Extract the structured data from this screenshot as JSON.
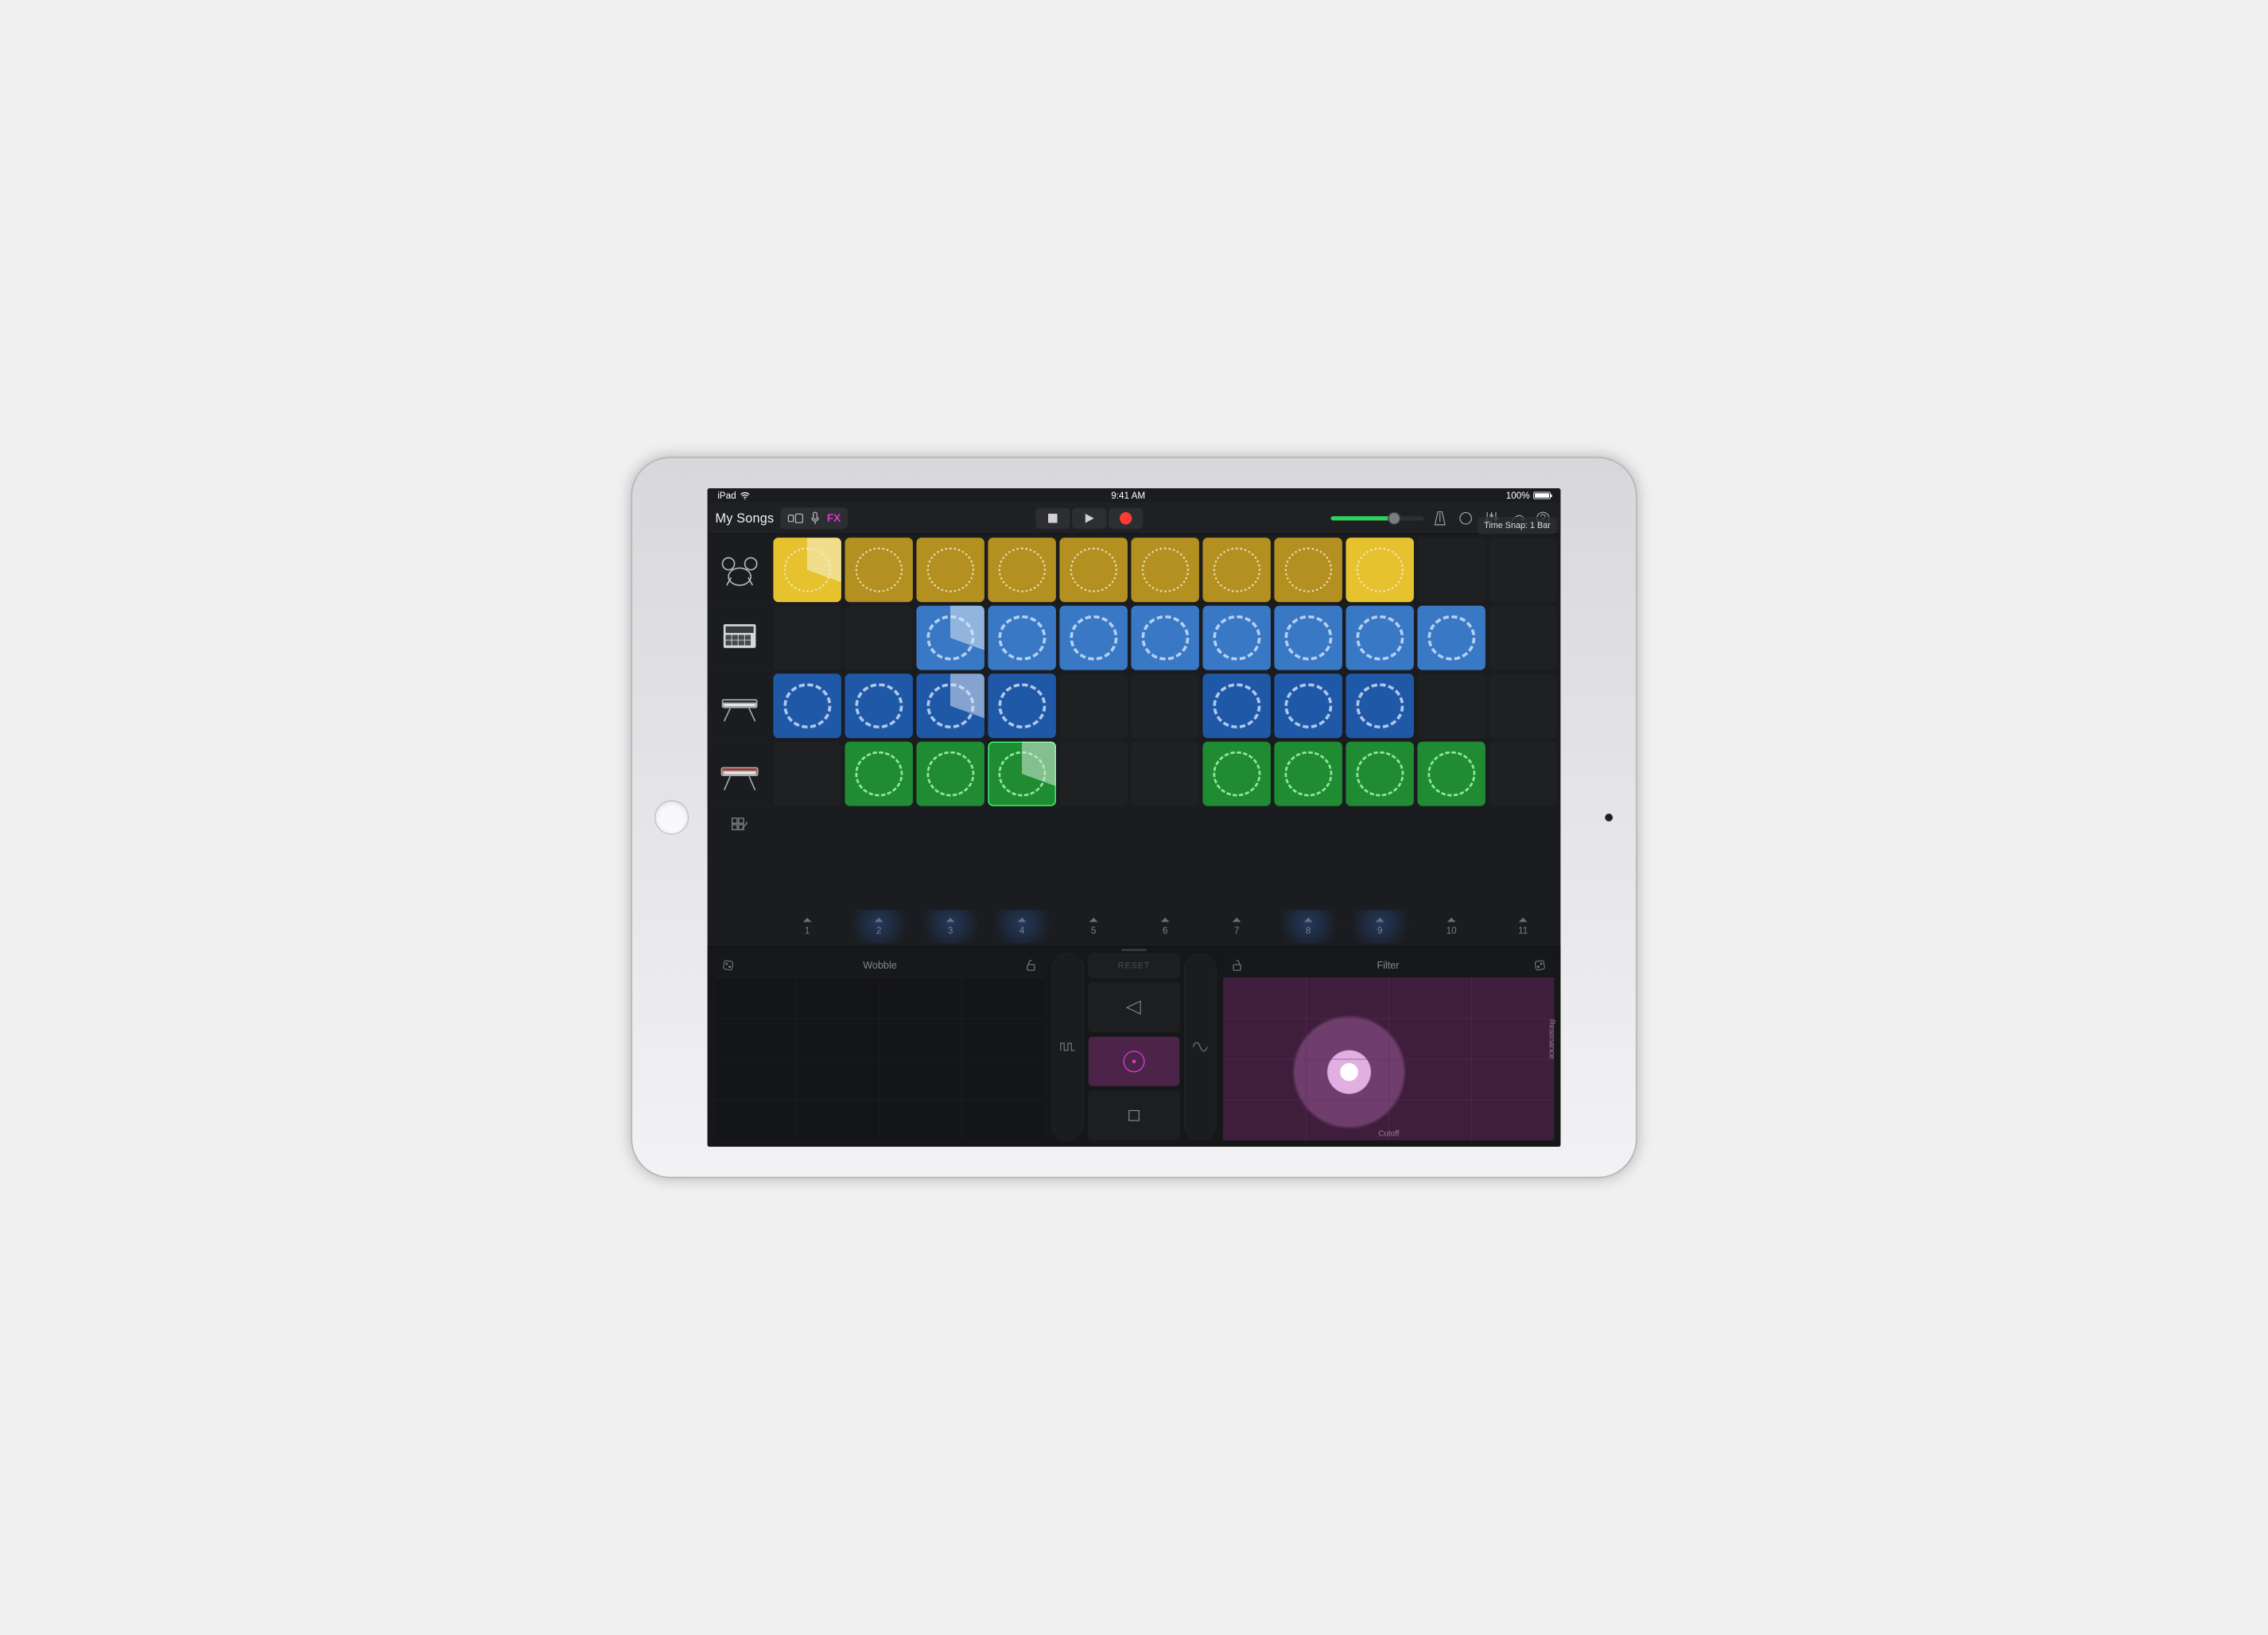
{
  "status": {
    "device": "iPad",
    "time": "9:41 AM",
    "battery": "100%"
  },
  "toolbar": {
    "title": "My Songs",
    "fx_label": "FX",
    "snap_label": "Time Snap: 1 Bar"
  },
  "tracks": [
    {
      "name": "Drums",
      "icon": "drums"
    },
    {
      "name": "Sampler",
      "icon": "sampler"
    },
    {
      "name": "Keys",
      "icon": "keys"
    },
    {
      "name": "Synth",
      "icon": "synth"
    }
  ],
  "columns": [
    "1",
    "2",
    "3",
    "4",
    "5",
    "6",
    "7",
    "8",
    "9",
    "10",
    "11"
  ],
  "column_glow": [
    false,
    true,
    true,
    true,
    false,
    false,
    false,
    true,
    true,
    false,
    false
  ],
  "grid": [
    [
      {
        "c": "yellow",
        "state": "playing",
        "bright": true
      },
      {
        "c": "yellow"
      },
      {
        "c": "yellow"
      },
      {
        "c": "yellow"
      },
      {
        "c": "yellow"
      },
      {
        "c": "yellow"
      },
      {
        "c": "yellow"
      },
      {
        "c": "yellow"
      },
      {
        "c": "yellow",
        "bright": true
      },
      null,
      null
    ],
    [
      null,
      null,
      {
        "c": "blue-lt",
        "state": "playing"
      },
      {
        "c": "blue-lt"
      },
      {
        "c": "blue-lt"
      },
      {
        "c": "blue-lt"
      },
      {
        "c": "blue-lt"
      },
      {
        "c": "blue-lt"
      },
      {
        "c": "blue-lt"
      },
      {
        "c": "blue-lt"
      },
      null
    ],
    [
      {
        "c": "blue-dk"
      },
      {
        "c": "blue-dk"
      },
      {
        "c": "blue-dk",
        "state": "playing"
      },
      {
        "c": "blue-dk"
      },
      null,
      null,
      {
        "c": "blue-dk"
      },
      {
        "c": "blue-dk"
      },
      {
        "c": "blue-dk"
      },
      null,
      null
    ],
    [
      null,
      {
        "c": "green"
      },
      {
        "c": "green"
      },
      {
        "c": "green",
        "state": "playing",
        "selected": true
      },
      null,
      null,
      {
        "c": "green"
      },
      {
        "c": "green"
      },
      {
        "c": "green"
      },
      {
        "c": "green"
      },
      null
    ]
  ],
  "fx": {
    "left_name": "Wobble",
    "right_name": "Filter",
    "right_x": "Cutoff",
    "right_y": "Resonance",
    "reset_label": "RESET"
  }
}
